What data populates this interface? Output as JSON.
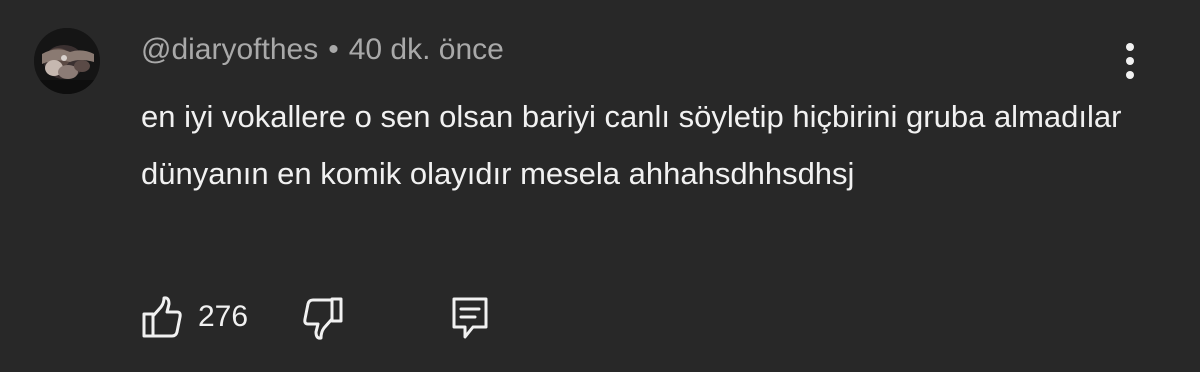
{
  "comment": {
    "author": "@diaryofthes",
    "separator": "•",
    "time": "40 dk. önce",
    "text": "en iyi vokallere o sen olsan bariyi canlı söyletip hiçbirini gruba almadılar dünyanın en komik olayıdır mesela ahhahsdhhsdhsj",
    "like_count": "276"
  },
  "icons": {
    "avatar": "avatar",
    "menu": "more-vertical-icon",
    "like": "thumbs-up-icon",
    "dislike": "thumbs-down-icon",
    "reply": "reply-comment-icon"
  },
  "colors": {
    "background": "#282828",
    "meta_text": "#a9a9a9",
    "body_text": "#f1f1f1"
  }
}
